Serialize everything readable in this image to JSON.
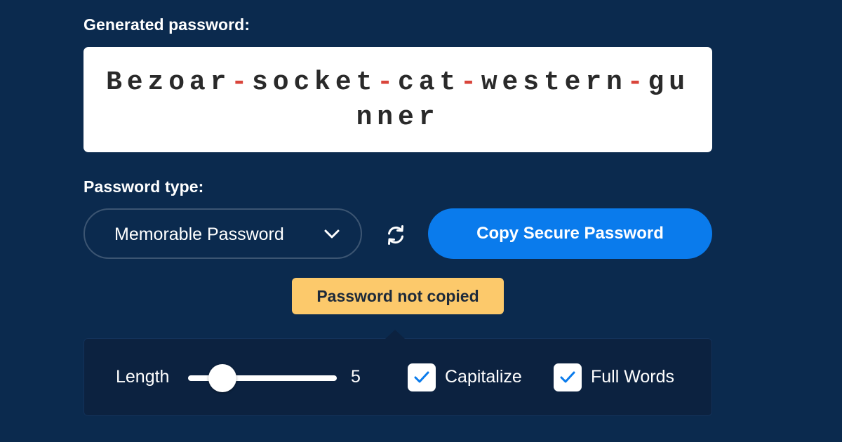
{
  "generator": {
    "generated_label": "Generated password:",
    "password_words": [
      "Bezoar",
      "socket",
      "cat",
      "western",
      "gunner"
    ],
    "separator": "-",
    "type_label": "Password type:",
    "type_value": "Memorable Password",
    "copy_button_label": "Copy Secure Password",
    "tooltip_text": "Password not copied"
  },
  "options": {
    "length_label": "Length",
    "length_value": "5",
    "capitalize_label": "Capitalize",
    "capitalize_checked": true,
    "full_words_label": "Full Words",
    "full_words_checked": true
  },
  "icons": {
    "type_dropdown": "chevron-down-icon",
    "regenerate": "refresh-icon",
    "checkbox": "checkmark-icon"
  },
  "colors": {
    "background": "#0b2a4e",
    "separator": "#d9453b",
    "primary_button": "#0a7bec",
    "tooltip": "#fcc96b",
    "panel": "#0c2240"
  }
}
